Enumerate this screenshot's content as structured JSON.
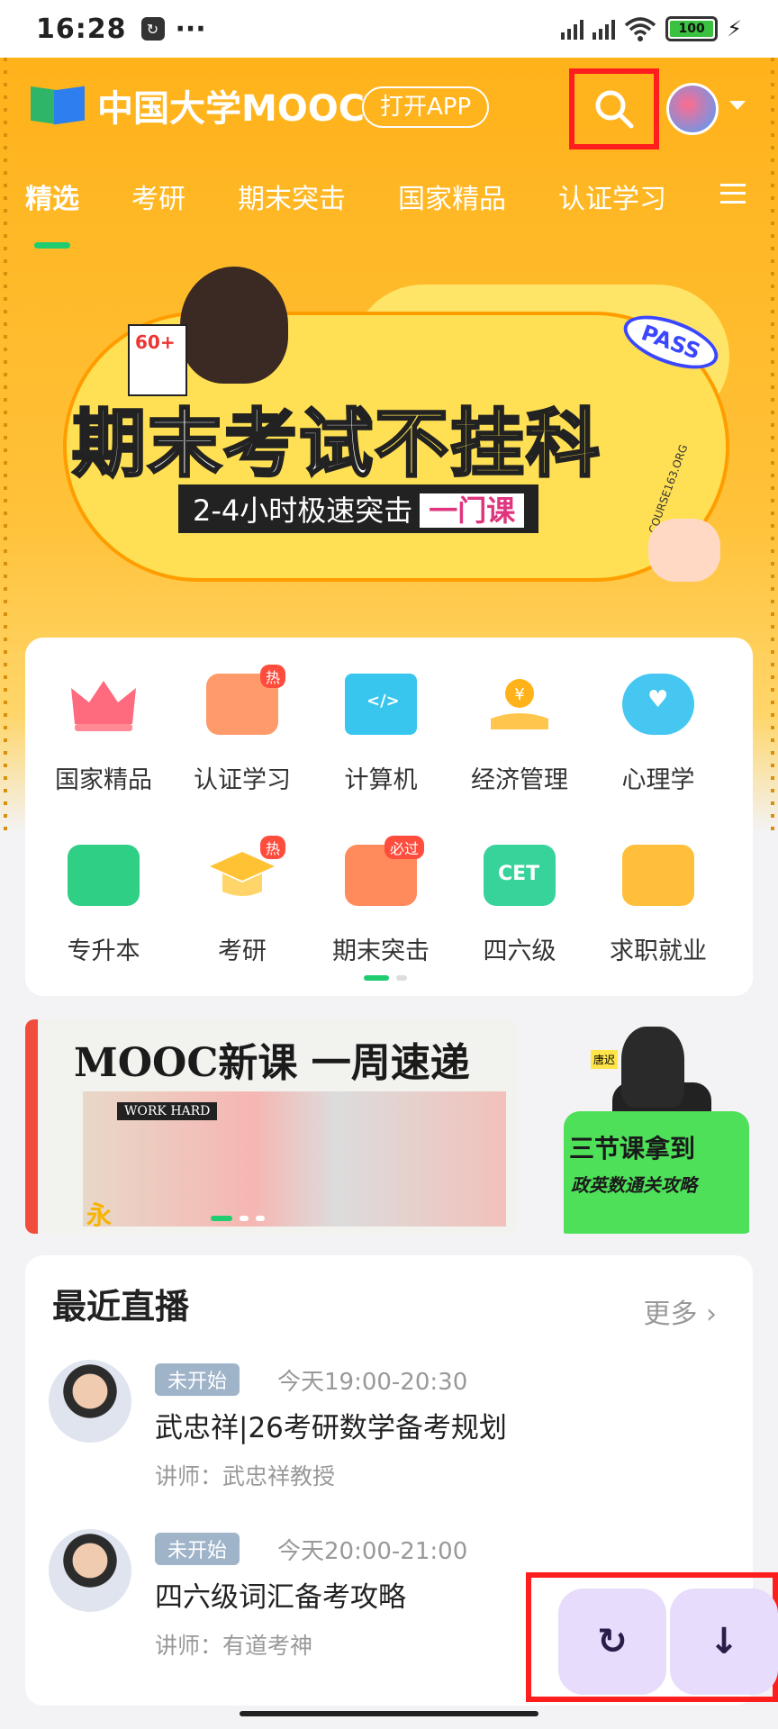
{
  "status_bar": {
    "time": "16:28",
    "more": "···",
    "battery": "100"
  },
  "header": {
    "logo_text": "中国大学MOOC",
    "open_app": "打开APP"
  },
  "tabs": [
    {
      "label": "精选",
      "active": true
    },
    {
      "label": "考研"
    },
    {
      "label": "期末突击"
    },
    {
      "label": "国家精品"
    },
    {
      "label": "认证学习"
    }
  ],
  "banner": {
    "title_a": "期末考试",
    "title_b": "不挂科",
    "subtitle": "2-4小时极速突击",
    "subtitle_tag": "一门课",
    "badge": "PASS",
    "card": "60+",
    "stamp": "COURSE163.ORG"
  },
  "categories": [
    {
      "label": "国家精品",
      "icon": "crown-icon"
    },
    {
      "label": "认证学习",
      "icon": "certificate-icon",
      "tag": "热"
    },
    {
      "label": "计算机",
      "icon": "monitor-code-icon"
    },
    {
      "label": "经济管理",
      "icon": "coin-hand-icon"
    },
    {
      "label": "心理学",
      "icon": "heart-chat-icon"
    },
    {
      "label": "专升本",
      "icon": "id-card-icon"
    },
    {
      "label": "考研",
      "icon": "grad-cap-icon",
      "tag": "热"
    },
    {
      "label": "期末突击",
      "icon": "exam-paper-icon",
      "tag": "必过"
    },
    {
      "label": "四六级",
      "icon": "cet-book-icon",
      "icon_text": "CET"
    },
    {
      "label": "求职就业",
      "icon": "briefcase-icon"
    }
  ],
  "promo_left": {
    "title": "MOOC新课 一周速递",
    "tag": "WORK HARD",
    "char": "永"
  },
  "promo_right": {
    "line1": "三节课拿到",
    "line2": "政英数通关攻略",
    "name": "唐迟"
  },
  "live": {
    "title": "最近直播",
    "more": "更多",
    "items": [
      {
        "status": "未开始",
        "time": "今天19:00-20:30",
        "title": "武忠祥|26考研数学备考规划",
        "lecturer": "讲师：武忠祥教授"
      },
      {
        "status": "未开始",
        "time": "今天20:00-21:00",
        "title": "四六级词汇备考攻略",
        "lecturer": "讲师：有道考神"
      }
    ]
  },
  "colors": {
    "accent": "#ffb21a",
    "highlight": "#ff1e1e",
    "green": "#1fcc70"
  }
}
